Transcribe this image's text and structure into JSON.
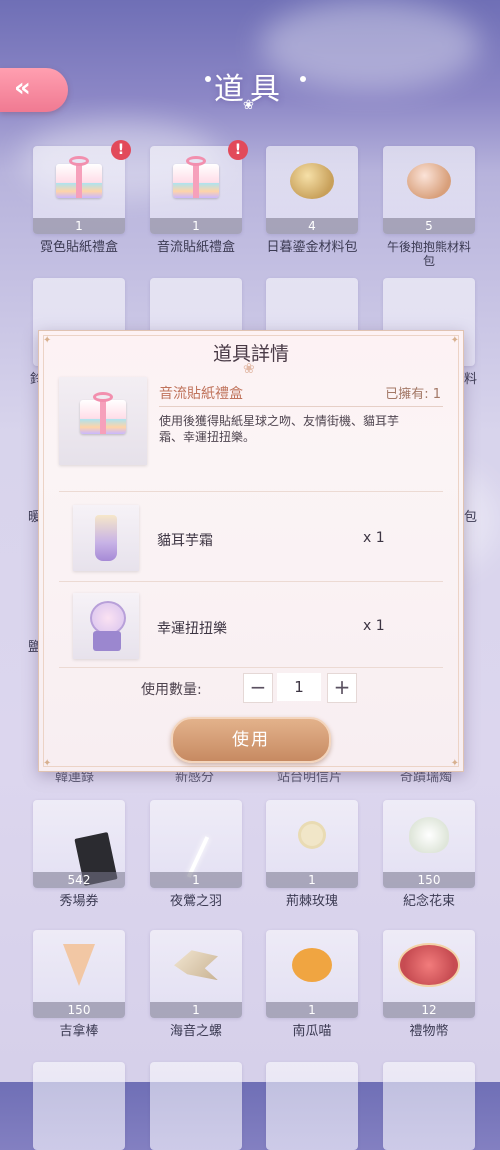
{
  "header": {
    "title": "道具",
    "back_label": "«"
  },
  "inventory": [
    {
      "name": "霓色貼紙禮盒",
      "qty": "1",
      "alert": "!",
      "icon": "gift-box-icon"
    },
    {
      "name": "音流貼紙禮盒",
      "qty": "1",
      "alert": "!",
      "icon": "gift-box-icon"
    },
    {
      "name": "日暮鎏金材料包",
      "qty": "4",
      "icon": "material-pack-icon"
    },
    {
      "name": "午後抱抱熊材料包",
      "qty": "5",
      "icon": "material-pack-icon"
    },
    {
      "name": "秀場券",
      "qty": "542",
      "icon": "ticket-icon"
    },
    {
      "name": "夜鶯之羽",
      "qty": "1",
      "icon": "feather-icon"
    },
    {
      "name": "荊棘玫瑰",
      "qty": "1",
      "icon": "rose-icon"
    },
    {
      "name": "紀念花束",
      "qty": "150",
      "icon": "bouquet-icon"
    },
    {
      "name": "吉拿棒",
      "qty": "150",
      "icon": "churro-icon"
    },
    {
      "name": "海音之螺",
      "qty": "1",
      "icon": "shell-icon"
    },
    {
      "name": "南瓜喵",
      "qty": "1",
      "icon": "pumpkin-cat-icon"
    },
    {
      "name": "禮物幣",
      "qty": "12",
      "icon": "gift-coin-icon"
    }
  ],
  "peek_text": {
    "left_row2": "鈴",
    "right_row2": "料",
    "left_row3": "暖",
    "right_row3": "包",
    "left_row4": "鹽",
    "row5": [
      "韓連錄",
      "新感分",
      "站台明信片",
      "奇蹟瑞燭"
    ]
  },
  "modal": {
    "title": "道具詳情",
    "item_name": "音流貼紙禮盒",
    "owned": "已擁有: 1",
    "description": "使用後獲得貼紙星球之吻、友情街機、貓耳芋霜、幸運扭扭樂。",
    "rewards": [
      {
        "name": "貓耳芋霜",
        "qty": "x 1",
        "icon": "taro-drink-icon"
      },
      {
        "name": "幸運扭扭樂",
        "qty": "x 1",
        "icon": "gumball-machine-icon"
      }
    ],
    "quantity_label": "使用數量:",
    "quantity_value": "1",
    "minus": "−",
    "plus": "+",
    "use_label": "使用"
  },
  "colors": {
    "accent": "#c78a62",
    "alert": "#e24a5a",
    "back_button": "#f07a92"
  }
}
